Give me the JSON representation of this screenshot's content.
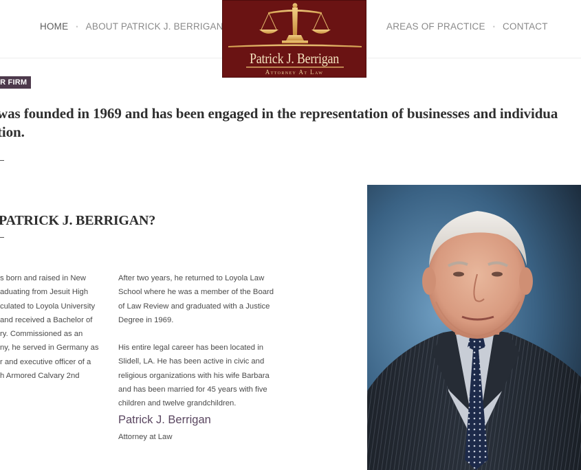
{
  "nav": {
    "home": "HOME",
    "about": "ABOUT PATRICK J. BERRIGAN",
    "areas": "AREAS OF PRACTICE",
    "contact": "CONTACT",
    "separator": "•"
  },
  "logo": {
    "name": "Patrick J. Berrigan",
    "tagline": "Attorney At Law",
    "colors": {
      "background": "#6a1313",
      "gold": "#e0b56a"
    }
  },
  "firm": {
    "badge": "UR FIRM",
    "intro_line1": "was founded in 1969 and has been engaged in the representation of businesses and individua",
    "intro_line2": "tion."
  },
  "who": {
    "heading": "PATRICK J. BERRIGAN?",
    "left_lines": [
      "s born and raised in New",
      "aduating from Jesuit High",
      "culated to Loyola University",
      "and received a Bachelor of",
      "ry. Commissioned as an",
      "ny, he served in Germany as",
      "r and executive officer of a",
      "h Armored Calvary 2nd"
    ],
    "right_para1": [
      "After two years, he returned to Loyola Law",
      "School where he was a member of the Board",
      "of Law Review and graduated with a Justice",
      "Degree in 1969."
    ],
    "right_para2": [
      "His entire legal career has been located in",
      "Slidell, LA. He has been active in civic and",
      "religious organizations with his wife Barbara",
      "and has been married for 45 years with five",
      "children and twelve grandchildren."
    ],
    "signature_name": "Patrick J. Berrigan",
    "signature_title": "Attorney at Law"
  },
  "colors": {
    "badge": "#4d3a4c",
    "signature": "#5a4660",
    "header_border": "#ececec"
  }
}
